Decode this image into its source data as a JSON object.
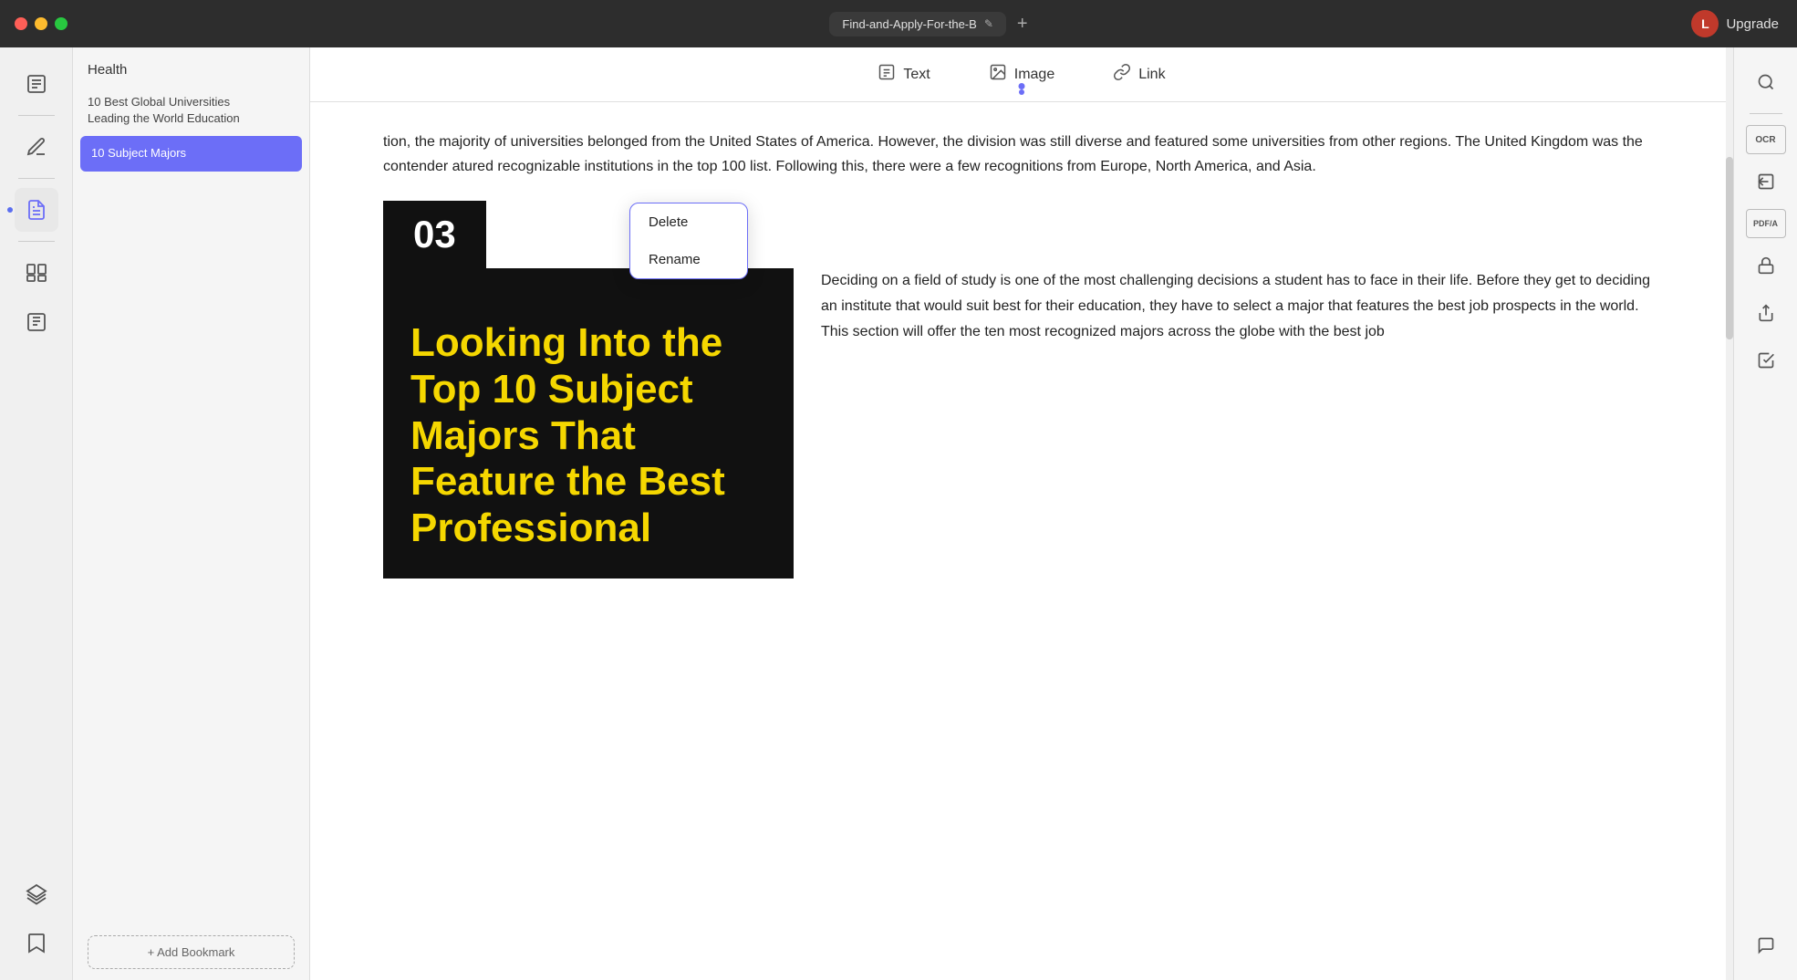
{
  "titlebar": {
    "tab_label": "Find-and-Apply-For-the-B",
    "edit_icon": "✎",
    "add_tab_icon": "+",
    "upgrade_label": "Upgrade",
    "avatar_initial": "L"
  },
  "left_sidebar": {
    "icons": [
      {
        "name": "bookmarks-icon",
        "symbol": "☰",
        "tooltip": "Bookmarks"
      },
      {
        "name": "divider1",
        "type": "divider"
      },
      {
        "name": "annotation-icon",
        "symbol": "✏",
        "tooltip": "Annotations"
      },
      {
        "name": "divider2",
        "type": "divider"
      },
      {
        "name": "notes-icon",
        "symbol": "📝",
        "tooltip": "Notes",
        "active": true
      },
      {
        "name": "divider3",
        "type": "divider"
      },
      {
        "name": "pages-icon",
        "symbol": "⊞",
        "tooltip": "Pages"
      },
      {
        "name": "attachments-icon",
        "symbol": "📎",
        "tooltip": "Attachments"
      },
      {
        "name": "divider4",
        "type": "divider"
      },
      {
        "name": "layers-icon",
        "symbol": "⧉",
        "tooltip": "Layers"
      },
      {
        "name": "bookmark-add-icon",
        "symbol": "🔖",
        "tooltip": "Add Bookmark"
      }
    ]
  },
  "bookmark_panel": {
    "category": "Health",
    "items": [
      {
        "label": "10 Best Global Universities\nLeading the World Education"
      },
      {
        "label": "10 Subject Majors",
        "selected": true
      }
    ],
    "add_button_label": "+ Add Bookmark"
  },
  "toolbar": {
    "items": [
      {
        "name": "text-tool",
        "label": "Text",
        "icon": "T"
      },
      {
        "name": "image-tool",
        "label": "Image",
        "icon": "🖼"
      },
      {
        "name": "link-tool",
        "label": "Link",
        "icon": "🔗"
      }
    ]
  },
  "context_menu": {
    "items": [
      {
        "name": "delete-item",
        "label": "Delete"
      },
      {
        "name": "rename-item",
        "label": "Rename"
      }
    ]
  },
  "content": {
    "paragraph1": "tion, the majority of universities belonged from the United States of America. However, the division was still diverse and featured some universities from other regions. The United Kingdom was the contender atured recognizable institutions in the top 100 list. Following this, there were a few recognitions from Europe, North America, and Asia.",
    "section_number": "03",
    "featured_title": "Looking Into the Top 10 Subject Majors That Feature the Best Professional",
    "side_text": "Deciding on a field of study is one of the most challenging decisions a student has to face in their life. Before they get to deciding an institute that would suit best for their education, they have to select a major that features the best job prospects in the world. This section will offer the ten most recognized majors across the globe with the best job"
  },
  "right_sidebar": {
    "icons": [
      {
        "name": "search-icon",
        "symbol": "🔍"
      },
      {
        "name": "divider1",
        "type": "divider"
      },
      {
        "name": "ocr-icon",
        "symbol": "OCR",
        "text": true
      },
      {
        "name": "extract-icon",
        "symbol": "⬇"
      },
      {
        "name": "pdfa-icon",
        "symbol": "PDF/A",
        "text": true
      },
      {
        "name": "lock-icon",
        "symbol": "🔒"
      },
      {
        "name": "share-icon",
        "symbol": "⬆"
      },
      {
        "name": "check-icon",
        "symbol": "☑"
      },
      {
        "name": "chat-icon",
        "symbol": "💬"
      }
    ]
  },
  "colors": {
    "accent": "#6c6ef7",
    "selected_bg": "#6c6ef7",
    "yellow": "#f5d700",
    "black": "#111111"
  }
}
